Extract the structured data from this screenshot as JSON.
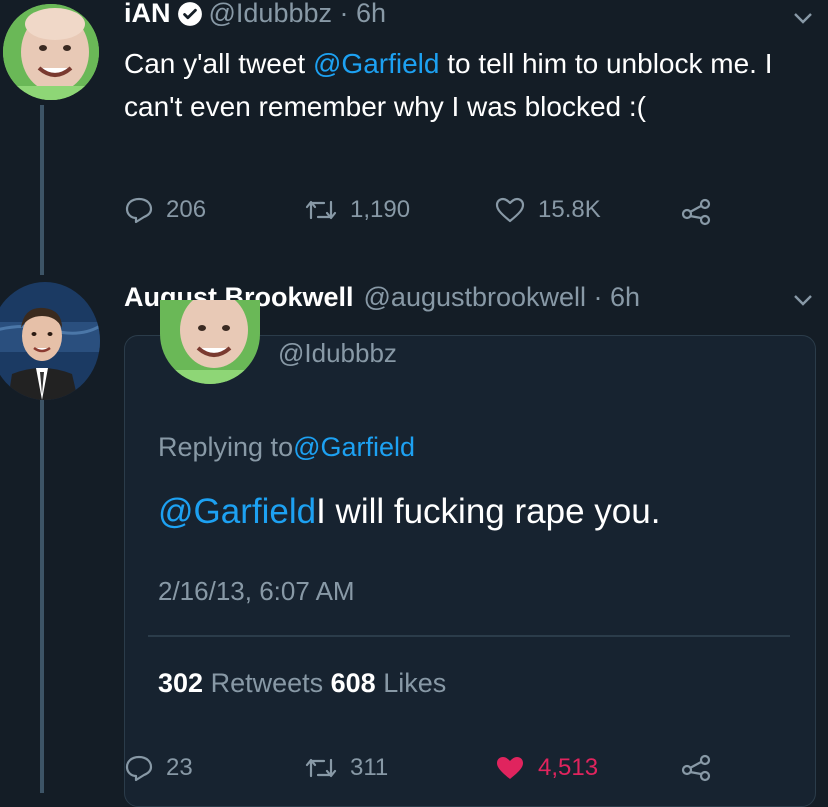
{
  "tweet1": {
    "name": "iAN",
    "handle_time": "@Idubbbz · 6h",
    "text_before": "Can y'all tweet ",
    "mention": "@Garfield",
    "text_after": " to tell him to unblock me. I can't even remember why I was blocked :(",
    "replies": "206",
    "retweets": "1,190",
    "likes": "15.8K"
  },
  "tweet2": {
    "name": "August Brookwell",
    "handle_time": "@augustbrookwell · 6h",
    "quoted": {
      "handle": "@Idubbbz",
      "replying_prefix": "Replying to ",
      "replying_to": "@Garfield",
      "mention": "@Garfield",
      "text": " I will fucking rape you.",
      "timestamp": "2/16/13, 6:07 AM",
      "retweets_count": "302",
      "retweets_label": " Retweets ",
      "likes_count": "608",
      "likes_label": " Likes"
    },
    "replies": "23",
    "retweets": "311",
    "likes": "4,513"
  },
  "colors": {
    "background": "#141d26",
    "link": "#1da1f2",
    "muted": "#8899a6",
    "liked": "#e0245e"
  }
}
